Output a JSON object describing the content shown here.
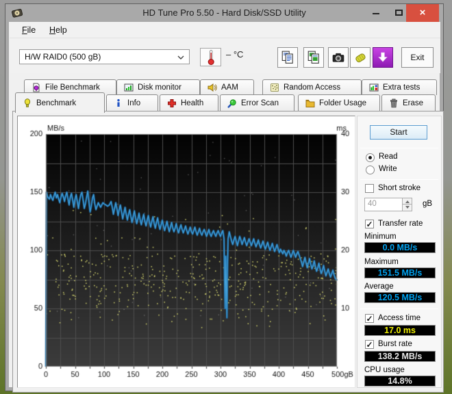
{
  "window": {
    "title": "HD Tune Pro 5.50 - Hard Disk/SSD Utility",
    "controls": {
      "minimize": "minimize",
      "maximize": "maximize",
      "close": "×"
    }
  },
  "menu": {
    "items": [
      "File",
      "Help"
    ]
  },
  "toolbar": {
    "drive_selector": "H/W RAID0 (500 gB)",
    "temperature_display": "– °C",
    "buttons": [
      "copy-text",
      "copy-image",
      "screenshot",
      "save",
      "download"
    ],
    "exit_label": "Exit"
  },
  "tabs": {
    "top_row": [
      {
        "label": "File Benchmark",
        "icon": "file-benchmark-icon"
      },
      {
        "label": "Disk monitor",
        "icon": "disk-monitor-icon"
      },
      {
        "label": "AAM",
        "icon": "aam-icon"
      },
      {
        "label": "Random Access",
        "icon": "random-access-icon"
      },
      {
        "label": "Extra tests",
        "icon": "extra-tests-icon"
      }
    ],
    "bottom_row": [
      {
        "label": "Benchmark",
        "icon": "benchmark-icon"
      },
      {
        "label": "Info",
        "icon": "info-icon"
      },
      {
        "label": "Health",
        "icon": "health-icon"
      },
      {
        "label": "Error Scan",
        "icon": "error-scan-icon"
      },
      {
        "label": "Folder Usage",
        "icon": "folder-usage-icon"
      },
      {
        "label": "Erase",
        "icon": "erase-icon"
      }
    ],
    "active": "Benchmark"
  },
  "panel": {
    "start_label": "Start",
    "mode": {
      "read": "Read",
      "write": "Write",
      "selected": "Read"
    },
    "short_stroke": {
      "label": "Short stroke",
      "checked": false,
      "value": "40",
      "unit": "gB"
    },
    "transfer_rate": {
      "label": "Transfer rate",
      "checked": true
    },
    "stats": {
      "minimum": {
        "label": "Minimum",
        "value": "0.0 MB/s",
        "color": "#00a2f0"
      },
      "maximum": {
        "label": "Maximum",
        "value": "151.5 MB/s",
        "color": "#00a2f0"
      },
      "average": {
        "label": "Average",
        "value": "120.5 MB/s",
        "color": "#00a2f0"
      }
    },
    "access_time": {
      "label": "Access time",
      "checked": true,
      "value": "17.0 ms",
      "color": "#f0f000"
    },
    "burst_rate": {
      "label": "Burst rate",
      "checked": true,
      "value": "138.2 MB/s",
      "color": "#e8e8e8"
    },
    "cpu_usage": {
      "label": "CPU usage",
      "value": "14.8%",
      "color": "#e8e8e8"
    }
  },
  "chart_data": {
    "type": "line",
    "title": "",
    "y_left": {
      "label": "MB/s",
      "min": 0,
      "max": 200,
      "tick_labels": [
        200,
        150,
        100,
        50,
        0
      ],
      "grid_step": 25
    },
    "y_right": {
      "label": "ms",
      "min": 0,
      "max": 40,
      "tick_labels": [
        40,
        30,
        20,
        10
      ],
      "grid_step": 5
    },
    "x": {
      "min": 0,
      "max": 500,
      "tick_labels": [
        "0",
        "50",
        "100",
        "150",
        "200",
        "250",
        "300",
        "350",
        "400",
        "450",
        "500gB"
      ],
      "grid_step": 25
    },
    "line_color": "#46a4dc",
    "line_edge_color": "#16629e",
    "grid_color": "#4e4e4e",
    "plot_bg_top": "#030303",
    "plot_bg_bottom": "#3c3c3c",
    "transfer_rate_series": [
      [
        0,
        0
      ],
      [
        1,
        150
      ],
      [
        3,
        146
      ],
      [
        6,
        144
      ],
      [
        8,
        148
      ],
      [
        10,
        145
      ],
      [
        12,
        143
      ],
      [
        14,
        147
      ],
      [
        16,
        150
      ],
      [
        18,
        145
      ],
      [
        20,
        148
      ],
      [
        22,
        144
      ],
      [
        24,
        141
      ],
      [
        26,
        146
      ],
      [
        28,
        149
      ],
      [
        30,
        146
      ],
      [
        32,
        142
      ],
      [
        34,
        147
      ],
      [
        36,
        150
      ],
      [
        38,
        144
      ],
      [
        40,
        139
      ],
      [
        42,
        146
      ],
      [
        44,
        149
      ],
      [
        46,
        143
      ],
      [
        48,
        137
      ],
      [
        50,
        144
      ],
      [
        52,
        148
      ],
      [
        54,
        142
      ],
      [
        56,
        136
      ],
      [
        58,
        143
      ],
      [
        60,
        148
      ],
      [
        62,
        150
      ],
      [
        64,
        143
      ],
      [
        66,
        136
      ],
      [
        68,
        140
      ],
      [
        70,
        146
      ],
      [
        72,
        151
      ],
      [
        74,
        141
      ],
      [
        76,
        133
      ],
      [
        78,
        138
      ],
      [
        80,
        145
      ],
      [
        82,
        148
      ],
      [
        84,
        140
      ],
      [
        86,
        135
      ],
      [
        88,
        138
      ],
      [
        90,
        141
      ],
      [
        92,
        139
      ],
      [
        94,
        137
      ],
      [
        96,
        139
      ],
      [
        98,
        141
      ],
      [
        100,
        140
      ],
      [
        103,
        139
      ],
      [
        106,
        138
      ],
      [
        109,
        139
      ],
      [
        112,
        142
      ],
      [
        114,
        137
      ],
      [
        116,
        131
      ],
      [
        118,
        136
      ],
      [
        120,
        141
      ],
      [
        122,
        136
      ],
      [
        124,
        130
      ],
      [
        126,
        135
      ],
      [
        128,
        139
      ],
      [
        130,
        133
      ],
      [
        132,
        127
      ],
      [
        134,
        132
      ],
      [
        136,
        137
      ],
      [
        138,
        131
      ],
      [
        140,
        126
      ],
      [
        142,
        131
      ],
      [
        144,
        135
      ],
      [
        146,
        129
      ],
      [
        148,
        124
      ],
      [
        150,
        129
      ],
      [
        152,
        134
      ],
      [
        154,
        128
      ],
      [
        156,
        123
      ],
      [
        158,
        127
      ],
      [
        160,
        132
      ],
      [
        162,
        126
      ],
      [
        164,
        122
      ],
      [
        166,
        127
      ],
      [
        168,
        131
      ],
      [
        170,
        125
      ],
      [
        172,
        121
      ],
      [
        174,
        126
      ],
      [
        176,
        130
      ],
      [
        178,
        124
      ],
      [
        180,
        120
      ],
      [
        182,
        125
      ],
      [
        184,
        129
      ],
      [
        186,
        123
      ],
      [
        188,
        119
      ],
      [
        190,
        124
      ],
      [
        192,
        128
      ],
      [
        194,
        122
      ],
      [
        196,
        118
      ],
      [
        198,
        122
      ],
      [
        200,
        126
      ],
      [
        202,
        121
      ],
      [
        204,
        117
      ],
      [
        206,
        121
      ],
      [
        208,
        125
      ],
      [
        210,
        120
      ],
      [
        212,
        116
      ],
      [
        214,
        120
      ],
      [
        216,
        124
      ],
      [
        218,
        119
      ],
      [
        220,
        116
      ],
      [
        222,
        119
      ],
      [
        224,
        123
      ],
      [
        226,
        118
      ],
      [
        228,
        115
      ],
      [
        230,
        119
      ],
      [
        232,
        122
      ],
      [
        234,
        118
      ],
      [
        236,
        115
      ],
      [
        238,
        118
      ],
      [
        240,
        121
      ],
      [
        242,
        117
      ],
      [
        244,
        114
      ],
      [
        246,
        117
      ],
      [
        248,
        120
      ],
      [
        250,
        116
      ],
      [
        252,
        114
      ],
      [
        254,
        117
      ],
      [
        256,
        120
      ],
      [
        258,
        116
      ],
      [
        260,
        113
      ],
      [
        262,
        116
      ],
      [
        264,
        119
      ],
      [
        266,
        115
      ],
      [
        268,
        113
      ],
      [
        270,
        116
      ],
      [
        272,
        118
      ],
      [
        274,
        115
      ],
      [
        276,
        112
      ],
      [
        278,
        115
      ],
      [
        280,
        118
      ],
      [
        282,
        114
      ],
      [
        284,
        112
      ],
      [
        286,
        115
      ],
      [
        288,
        117
      ],
      [
        290,
        114
      ],
      [
        292,
        112
      ],
      [
        294,
        115
      ],
      [
        296,
        117
      ],
      [
        298,
        114
      ],
      [
        300,
        112
      ],
      [
        302,
        115
      ],
      [
        304,
        117
      ],
      [
        306,
        110
      ],
      [
        307,
        75
      ],
      [
        308,
        50
      ],
      [
        309,
        95
      ],
      [
        310,
        70
      ],
      [
        311,
        42
      ],
      [
        312,
        85
      ],
      [
        313,
        110
      ],
      [
        315,
        116
      ],
      [
        317,
        112
      ],
      [
        319,
        108
      ],
      [
        321,
        105
      ],
      [
        323,
        109
      ],
      [
        325,
        112
      ],
      [
        327,
        108
      ],
      [
        329,
        104
      ],
      [
        331,
        108
      ],
      [
        333,
        112
      ],
      [
        335,
        109
      ],
      [
        337,
        105
      ],
      [
        339,
        108
      ],
      [
        341,
        111
      ],
      [
        343,
        107
      ],
      [
        345,
        104
      ],
      [
        347,
        107
      ],
      [
        349,
        110
      ],
      [
        351,
        107
      ],
      [
        353,
        104
      ],
      [
        355,
        107
      ],
      [
        357,
        110
      ],
      [
        359,
        106
      ],
      [
        361,
        103
      ],
      [
        363,
        106
      ],
      [
        365,
        109
      ],
      [
        367,
        105
      ],
      [
        369,
        102
      ],
      [
        371,
        105
      ],
      [
        373,
        108
      ],
      [
        375,
        104
      ],
      [
        377,
        101
      ],
      [
        379,
        104
      ],
      [
        381,
        107
      ],
      [
        383,
        103
      ],
      [
        385,
        100
      ],
      [
        387,
        103
      ],
      [
        389,
        106
      ],
      [
        391,
        102
      ],
      [
        393,
        99
      ],
      [
        395,
        102
      ],
      [
        397,
        105
      ],
      [
        399,
        101
      ],
      [
        401,
        98
      ],
      [
        403,
        101
      ],
      [
        405,
        99
      ],
      [
        407,
        97
      ],
      [
        409,
        100
      ],
      [
        411,
        98
      ],
      [
        413,
        95
      ],
      [
        415,
        98
      ],
      [
        417,
        100
      ],
      [
        419,
        97
      ],
      [
        421,
        94
      ],
      [
        423,
        97
      ],
      [
        425,
        100
      ],
      [
        427,
        97
      ],
      [
        429,
        94
      ],
      [
        431,
        97
      ],
      [
        433,
        99
      ],
      [
        435,
        96
      ],
      [
        437,
        93
      ],
      [
        439,
        90
      ],
      [
        441,
        86
      ],
      [
        443,
        90
      ],
      [
        445,
        94
      ],
      [
        447,
        89
      ],
      [
        449,
        85
      ],
      [
        451,
        89
      ],
      [
        453,
        93
      ],
      [
        455,
        88
      ],
      [
        457,
        84
      ],
      [
        459,
        87
      ],
      [
        461,
        91
      ],
      [
        463,
        86
      ],
      [
        465,
        82
      ],
      [
        467,
        85
      ],
      [
        469,
        89
      ],
      [
        471,
        84
      ],
      [
        473,
        80
      ],
      [
        475,
        83
      ],
      [
        477,
        87
      ],
      [
        479,
        82
      ],
      [
        481,
        78
      ],
      [
        483,
        81
      ],
      [
        485,
        84
      ],
      [
        487,
        80
      ],
      [
        489,
        77
      ],
      [
        491,
        80
      ],
      [
        493,
        83
      ],
      [
        495,
        79
      ],
      [
        497,
        76
      ],
      [
        499,
        75
      ],
      [
        500,
        74
      ]
    ],
    "access_time_scatter": {
      "color": "#d6d66e",
      "count": 430,
      "ms_band": [
        6.5,
        19.5
      ],
      "outlier_count": 28,
      "outlier_ms_band": [
        19.5,
        28
      ]
    },
    "noise_dots": {
      "color": "#c8c8c8",
      "count": 70
    }
  }
}
